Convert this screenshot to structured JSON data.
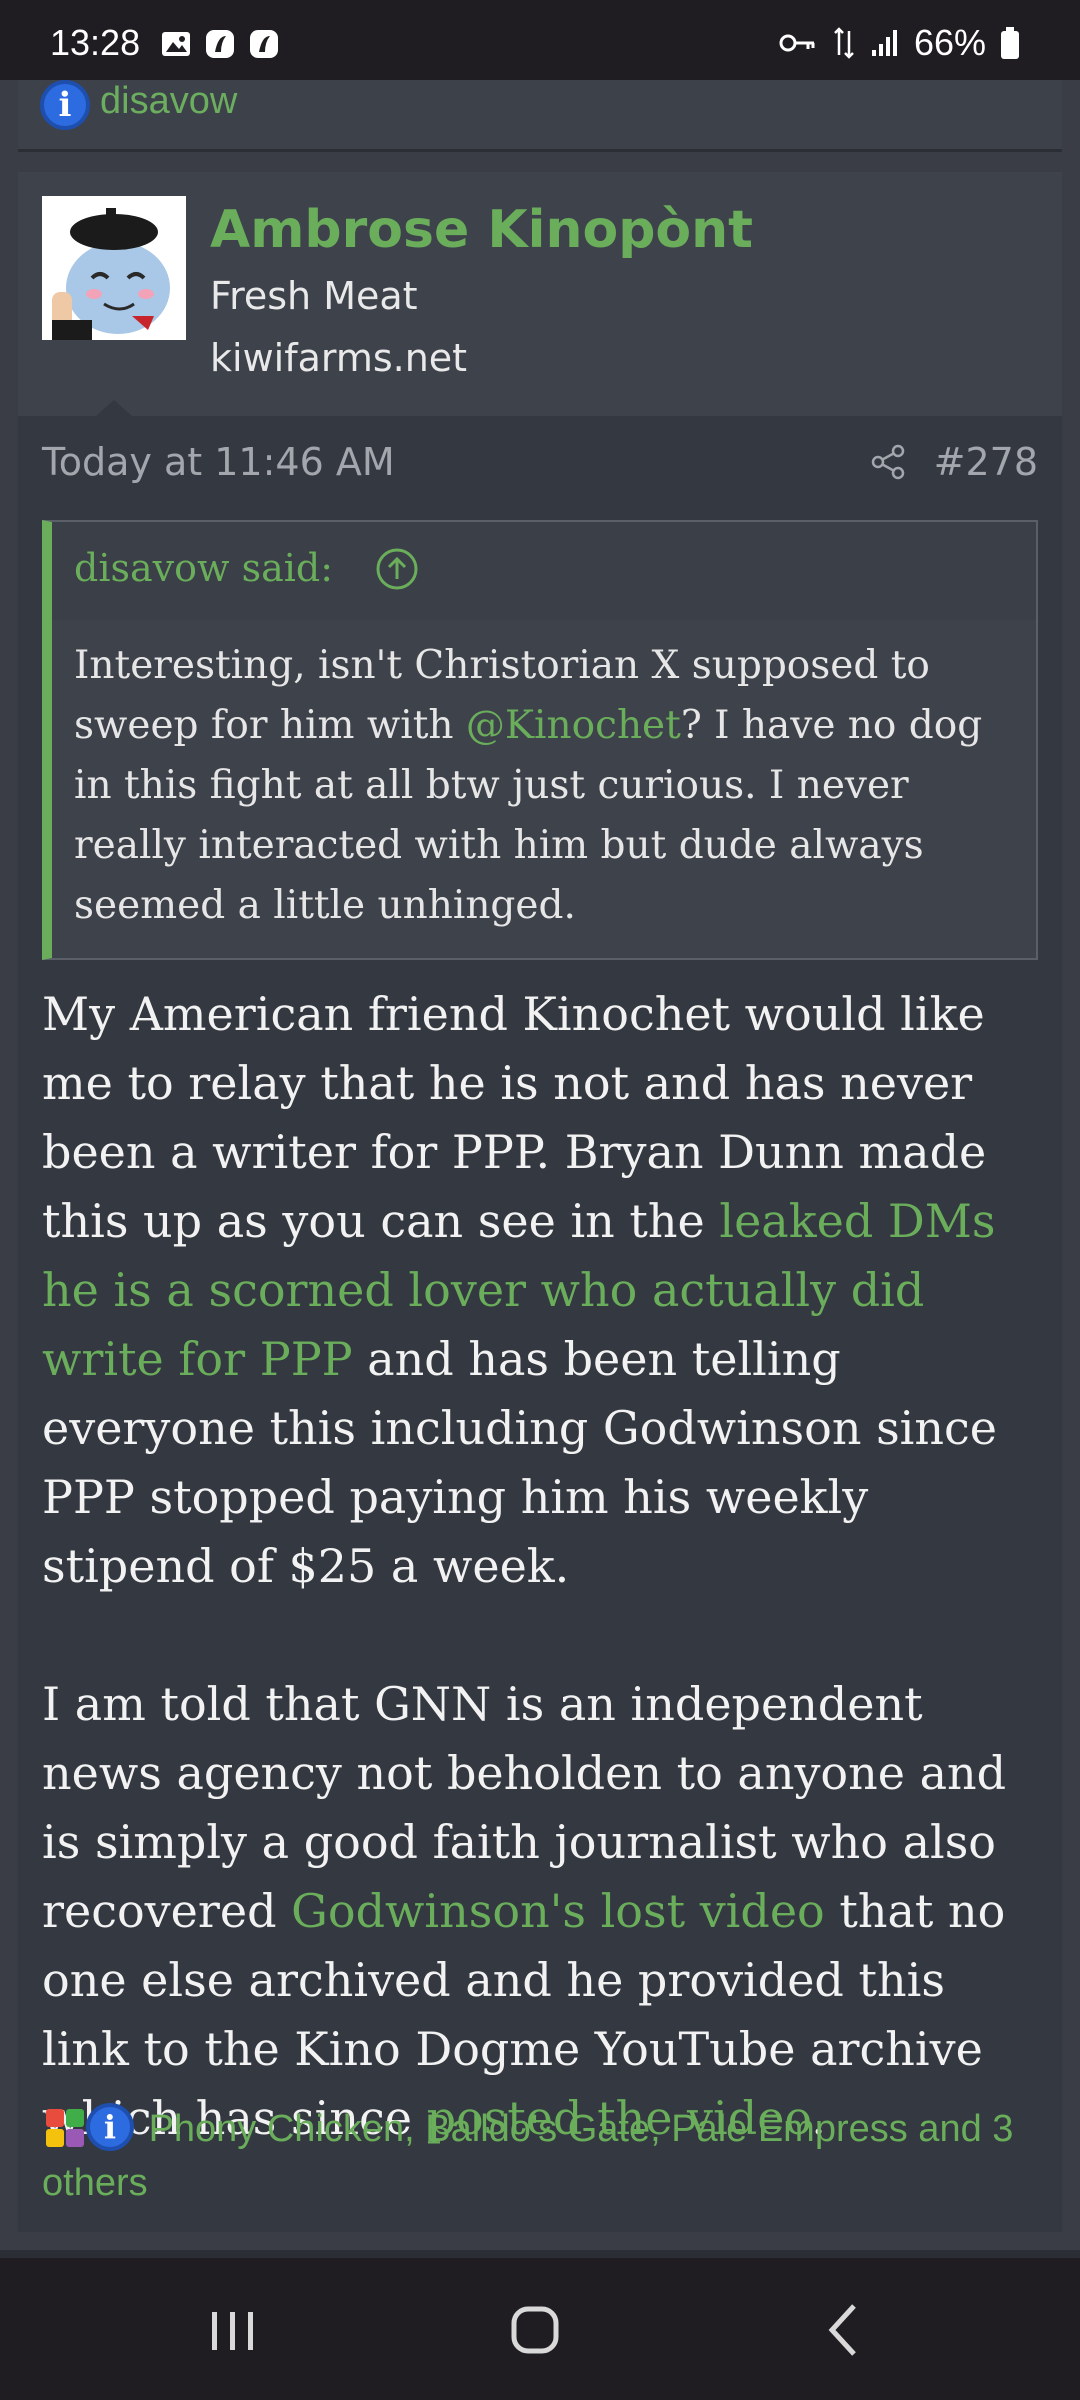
{
  "status_bar": {
    "time": "13:28",
    "battery": "66%",
    "icons": [
      "image-icon",
      "app-icon",
      "app-icon",
      "vpn-key-icon",
      "data-arrows-icon",
      "signal-icon",
      "battery-icon"
    ]
  },
  "previous_post": {
    "reaction_text": "disavow"
  },
  "post": {
    "username": "Ambrose Kinopònt",
    "user_title": "Fresh Meat",
    "user_site": "kiwifarms.net",
    "date": "Today at 11:46 AM",
    "post_number": "#278",
    "quote": {
      "attribution": "disavow said:",
      "body_part1": "Interesting, isn't Christorian X supposed to sweep for him with ",
      "mention": "@Kinochet",
      "body_part2": "? I have no dog in this fight at all btw just curious. I never really interacted with him but dude always seemed a little unhinged."
    },
    "body": {
      "p1_part1": "My American friend Kinochet would like me to relay that he is not and has never been a writer for PPP. Bryan Dunn made this up as you can see in the ",
      "p1_link": "leaked DMs he is a scorned lover who actually did write for PPP",
      "p1_part2": " and has been telling everyone this including Godwinson since PPP stopped paying him his weekly stipend of $25 a week.",
      "p2_part1": "I am told that GNN is an independent news agency not beholden to anyone and is simply a good faith journalist who also recovered ",
      "p2_link1": "Godwinson's lost video",
      "p2_part2": " that no one else archived and he provided this link to the Kino Dogme YouTube archive which has since ",
      "p2_link2": "posted the video",
      "p2_part3": "."
    },
    "reactions": {
      "text": "Phony Chicken, Balldo's Gate, Pale Empress and 3 others"
    }
  },
  "colors": {
    "accent_green": "#6aad5b",
    "background": "#343840",
    "header_bg": "#3e424b",
    "info_blue": "#2d6be0"
  }
}
